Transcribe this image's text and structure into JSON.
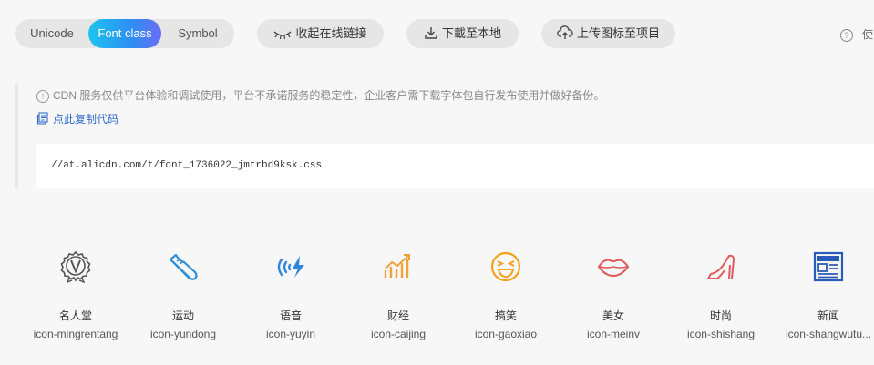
{
  "toolbar": {
    "tabs": [
      "Unicode",
      "Font class",
      "Symbol"
    ],
    "collapse_label": "收起在线链接",
    "download_label": "下載至本地",
    "upload_label": "上传图标至项目",
    "help_label": "使"
  },
  "notice": {
    "text": "CDN 服务仅供平台体验和调试使用，平台不承诺服务的稳定性，企业客户需下载字体包自行发布使用并做好备份。",
    "copy_label": "点此复制代码",
    "code": "//at.alicdn.com/t/font_1736022_jmtrbd9ksk.css"
  },
  "icons": [
    {
      "name": "名人堂",
      "class": "icon-mingrentang",
      "icon": "medal-v-icon",
      "color": "#555555"
    },
    {
      "name": "运动",
      "class": "icon-yundong",
      "icon": "sneaker-icon",
      "color": "#2e8fd8"
    },
    {
      "name": "语音",
      "class": "icon-yuyin",
      "icon": "voice-icon",
      "color": "#2e86de"
    },
    {
      "name": "财经",
      "class": "icon-caijing",
      "icon": "finance-chart-icon",
      "color": "#f0a23a"
    },
    {
      "name": "搞笑",
      "class": "icon-gaoxiao",
      "icon": "laugh-face-icon",
      "color": "#f4a11e"
    },
    {
      "name": "美女",
      "class": "icon-meinv",
      "icon": "lips-icon",
      "color": "#e05a5a"
    },
    {
      "name": "时尚",
      "class": "icon-shishang",
      "icon": "high-heel-icon",
      "color": "#e05a5a"
    },
    {
      "name": "新闻",
      "class": "icon-shangwutu...",
      "icon": "newspaper-icon",
      "color": "#2a5bb8"
    }
  ]
}
